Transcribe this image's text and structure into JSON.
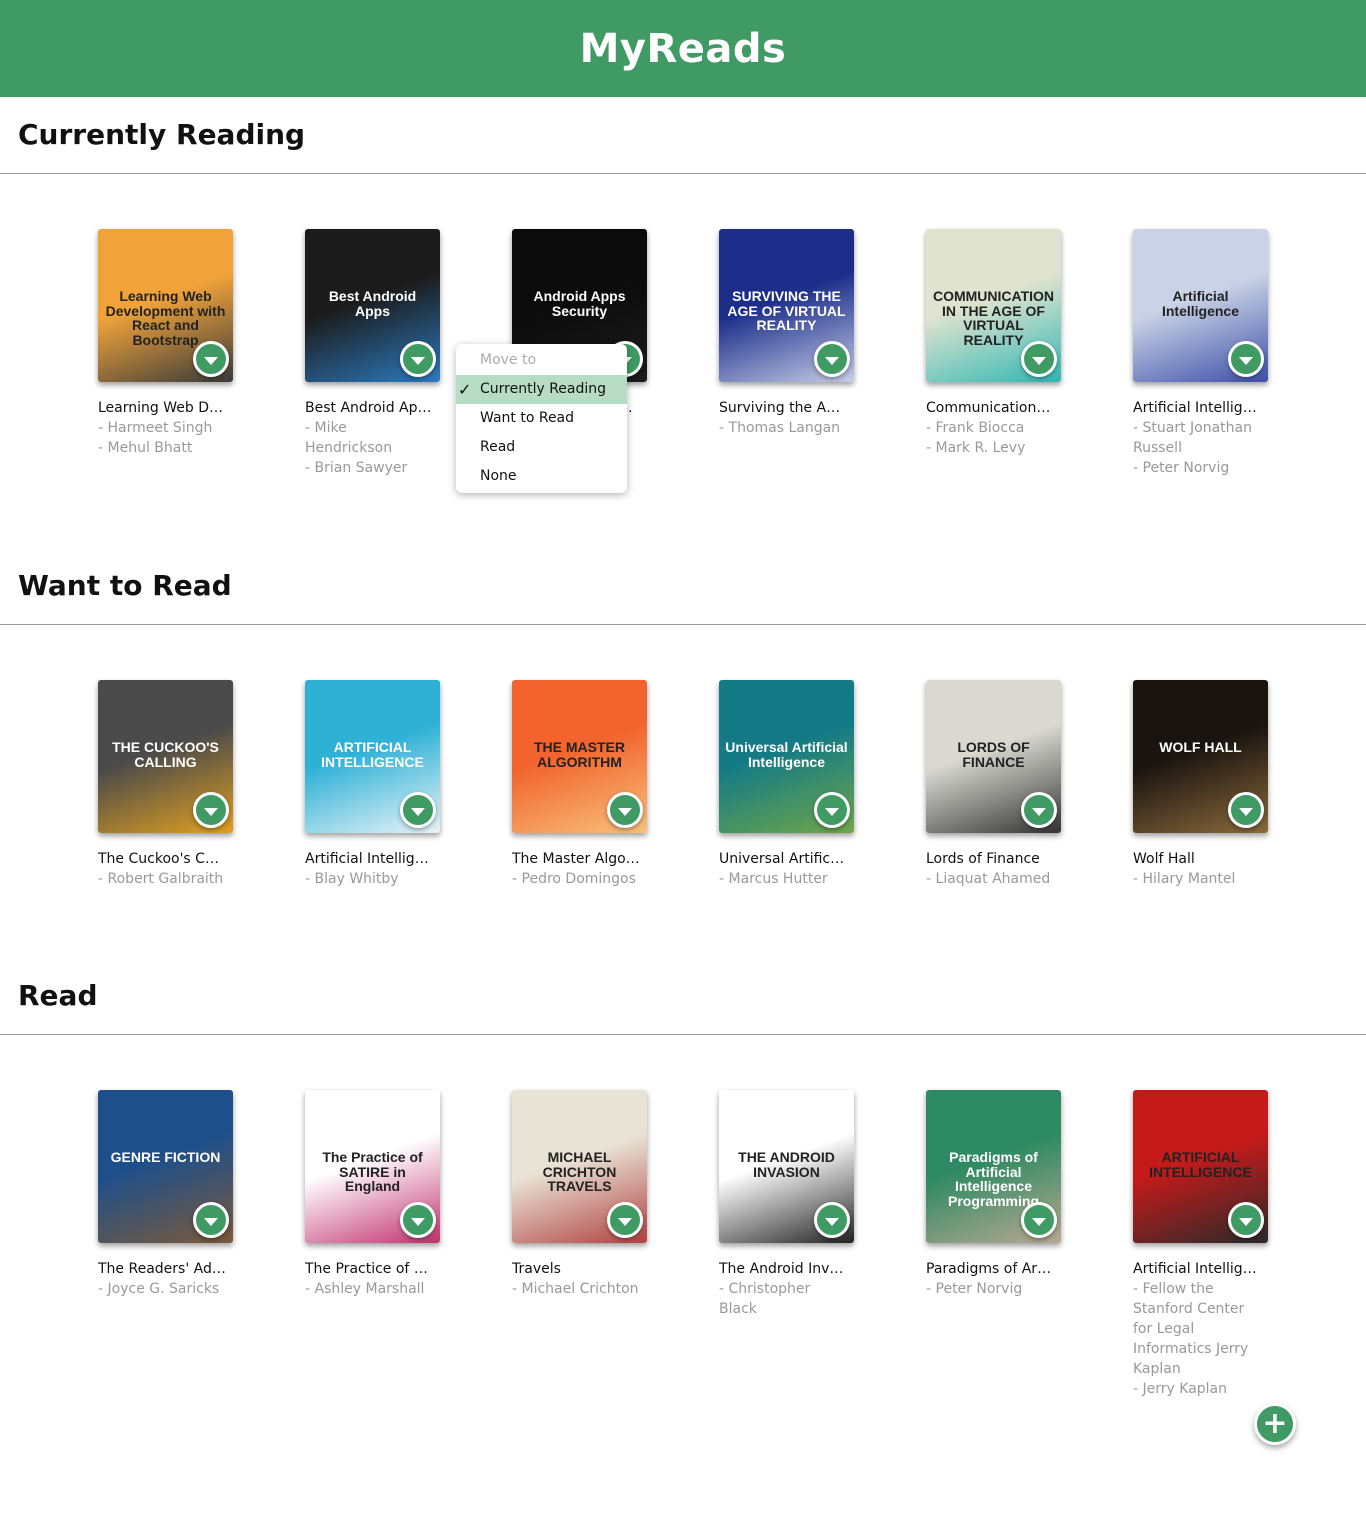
{
  "app": {
    "title": "MyReads"
  },
  "shelves": [
    {
      "title": "Currently Reading",
      "books": [
        {
          "title": "Learning Web Development with React and Bootstrap",
          "authors": [
            "Harmeet Singh",
            "Mehul Bhatt"
          ],
          "cover_text": "Learning Web Development with React and Bootstrap",
          "cover_colors": [
            "#f1a33a",
            "#3a3a3a"
          ]
        },
        {
          "title": "Best Android Apps",
          "authors": [
            "Mike Hendrickson",
            "Brian Sawyer"
          ],
          "cover_text": "Best Android Apps",
          "cover_colors": [
            "#1b1b1b",
            "#2c7bc0"
          ]
        },
        {
          "title": "Android Apps Security",
          "authors": [],
          "cover_text": "Android Apps Security",
          "cover_colors": [
            "#0b0b0b",
            "#1d1d1d"
          ]
        },
        {
          "title": "Surviving the Age of Virtual Reality",
          "authors": [
            "Thomas Langan"
          ],
          "cover_text": "SURVIVING THE AGE OF VIRTUAL REALITY",
          "cover_colors": [
            "#1c2e8a",
            "#c6cde8"
          ]
        },
        {
          "title": "Communication in the Age of Virtual Reality",
          "authors": [
            "Frank Biocca",
            "Mark R. Levy"
          ],
          "cover_text": "COMMUNICATION IN THE AGE OF VIRTUAL REALITY",
          "cover_colors": [
            "#dfe3cf",
            "#30b7b3"
          ]
        },
        {
          "title": "Artificial Intelligence: A Modern Approach",
          "authors": [
            "Stuart Jonathan Russell",
            "Peter Norvig"
          ],
          "cover_text": "Artificial Intelligence",
          "cover_colors": [
            "#c9d2e6",
            "#3d4fa8"
          ]
        }
      ]
    },
    {
      "title": "Want to Read",
      "books": [
        {
          "title": "The Cuckoo's Calling",
          "authors": [
            "Robert Galbraith"
          ],
          "cover_text": "THE CUCKOO'S CALLING",
          "cover_colors": [
            "#4a4a4a",
            "#e0a020"
          ]
        },
        {
          "title": "Artificial Intelligence",
          "authors": [
            "Blay Whitby"
          ],
          "cover_text": "ARTIFICIAL INTELLIGENCE",
          "cover_colors": [
            "#2fb1d6",
            "#e9f4f8"
          ]
        },
        {
          "title": "The Master Algorithm",
          "authors": [
            "Pedro Domingos"
          ],
          "cover_text": "THE MASTER ALGORITHM",
          "cover_colors": [
            "#f2632d",
            "#f7c17c"
          ]
        },
        {
          "title": "Universal Artificial Intelligence",
          "authors": [
            "Marcus Hutter"
          ],
          "cover_text": "Universal Artificial Intelligence",
          "cover_colors": [
            "#137a86",
            "#6fa64a"
          ]
        },
        {
          "title": "Lords of Finance",
          "authors": [
            "Liaquat Ahamed"
          ],
          "cover_text": "LORDS OF FINANCE",
          "cover_colors": [
            "#d9d9d2",
            "#333"
          ]
        },
        {
          "title": "Wolf Hall",
          "authors": [
            "Hilary Mantel"
          ],
          "cover_text": "WOLF HALL",
          "cover_colors": [
            "#1a1410",
            "#8a6a3a"
          ]
        }
      ]
    },
    {
      "title": "Read",
      "books": [
        {
          "title": "The Readers' Advisory Guide to Genre Fiction",
          "authors": [
            "Joyce G. Saricks"
          ],
          "cover_text": "GENRE FICTION",
          "cover_colors": [
            "#1f4f8a",
            "#7b5a3a"
          ]
        },
        {
          "title": "The Practice of Satire in England",
          "authors": [
            "Ashley Marshall"
          ],
          "cover_text": "The Practice of SATIRE in England",
          "cover_colors": [
            "#ffffff",
            "#c0306e"
          ]
        },
        {
          "title": "Travels",
          "authors": [
            "Michael Crichton"
          ],
          "cover_text": "MICHAEL CRICHTON TRAVELS",
          "cover_colors": [
            "#e9e3d6",
            "#b04040"
          ]
        },
        {
          "title": "The Android Invasion",
          "authors": [
            "Christopher Black"
          ],
          "cover_text": "THE ANDROID INVASION",
          "cover_colors": [
            "#ffffff",
            "#222"
          ]
        },
        {
          "title": "Paradigms of Artificial Intelligence Programming",
          "authors": [
            "Peter Norvig"
          ],
          "cover_text": "Paradigms of Artificial Intelligence Programming",
          "cover_colors": [
            "#2e8a62",
            "#b8a892"
          ]
        },
        {
          "title": "Artificial Intelligence",
          "authors": [
            "Fellow the Stanford Center for Legal Informatics Jerry Kaplan",
            "Jerry Kaplan"
          ],
          "cover_text": "ARTIFICIAL INTELLIGENCE",
          "cover_colors": [
            "#c41a1a",
            "#2a2a2a"
          ]
        }
      ]
    }
  ],
  "shelf_menu": {
    "header": "Move to",
    "options": [
      "Currently Reading",
      "Want to Read",
      "Read",
      "None"
    ],
    "selected": "Currently Reading",
    "check_icon": "check-icon"
  },
  "icons": {
    "changer": "chevron-down-icon",
    "add": "plus-icon"
  },
  "add_button": {
    "label": "+"
  },
  "colors": {
    "header_bg": "#3f9a63",
    "accent": "#3f9a63",
    "selected_bg": "#b6dcc4",
    "author_text": "#999999"
  }
}
